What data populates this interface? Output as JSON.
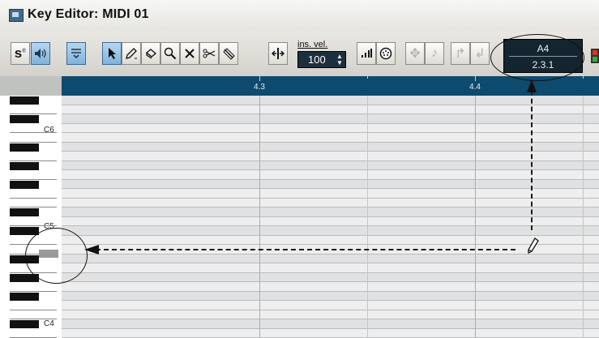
{
  "window": {
    "title": "Key Editor: MIDI 01"
  },
  "toolbar": {
    "buttons": [
      {
        "name": "solo-button",
        "icon": "solo-icon",
        "glyph": "s"
      },
      {
        "name": "acoustic-feedback-button",
        "icon": "speaker-icon",
        "glyph": "🔈"
      },
      {
        "name": "show-info-button",
        "icon": "info-line-icon",
        "glyph": "≡"
      },
      {
        "name": "object-selection-tool",
        "icon": "arrow-pointer-icon",
        "glyph": "▲"
      },
      {
        "name": "draw-tool",
        "icon": "pencil-icon",
        "glyph": "✎"
      },
      {
        "name": "erase-tool",
        "icon": "eraser-icon",
        "glyph": "◇"
      },
      {
        "name": "zoom-tool",
        "icon": "magnifier-icon",
        "glyph": "🔍"
      },
      {
        "name": "mute-tool",
        "icon": "x-icon",
        "glyph": "✕"
      },
      {
        "name": "split-tool",
        "icon": "scissors-icon",
        "glyph": "✂"
      },
      {
        "name": "line-tool",
        "icon": "line-icon",
        "glyph": "∕"
      },
      {
        "name": "autoscroll-button",
        "icon": "autoscroll-icon",
        "glyph": "⇥"
      },
      {
        "name": "step-input-button",
        "icon": "step-input-icon",
        "glyph": "▮"
      },
      {
        "name": "midi-input-button",
        "icon": "midi-plug-icon",
        "glyph": "◉"
      },
      {
        "name": "move-insert-button",
        "icon": "move-insert-icon",
        "glyph": "✥"
      },
      {
        "name": "pitch-button",
        "icon": "note-icon",
        "glyph": "♪"
      },
      {
        "name": "select-button",
        "icon": "select-icon",
        "glyph": "↱"
      },
      {
        "name": "length-button",
        "icon": "length-icon",
        "glyph": "↲"
      }
    ],
    "ins_vel": {
      "label": "ins. vel.",
      "value": "100"
    },
    "position_display": {
      "pitch": "A4",
      "position": "2.3.1"
    }
  },
  "ruler": {
    "labels": [
      "4.3",
      "4.4"
    ]
  },
  "keyboard": {
    "labels": [
      "C6",
      "C5",
      "C4"
    ]
  },
  "colors": {
    "ruler_bg": "#0e4a6e",
    "active_button": "#7fb3db",
    "display_bg": "#14252f"
  }
}
